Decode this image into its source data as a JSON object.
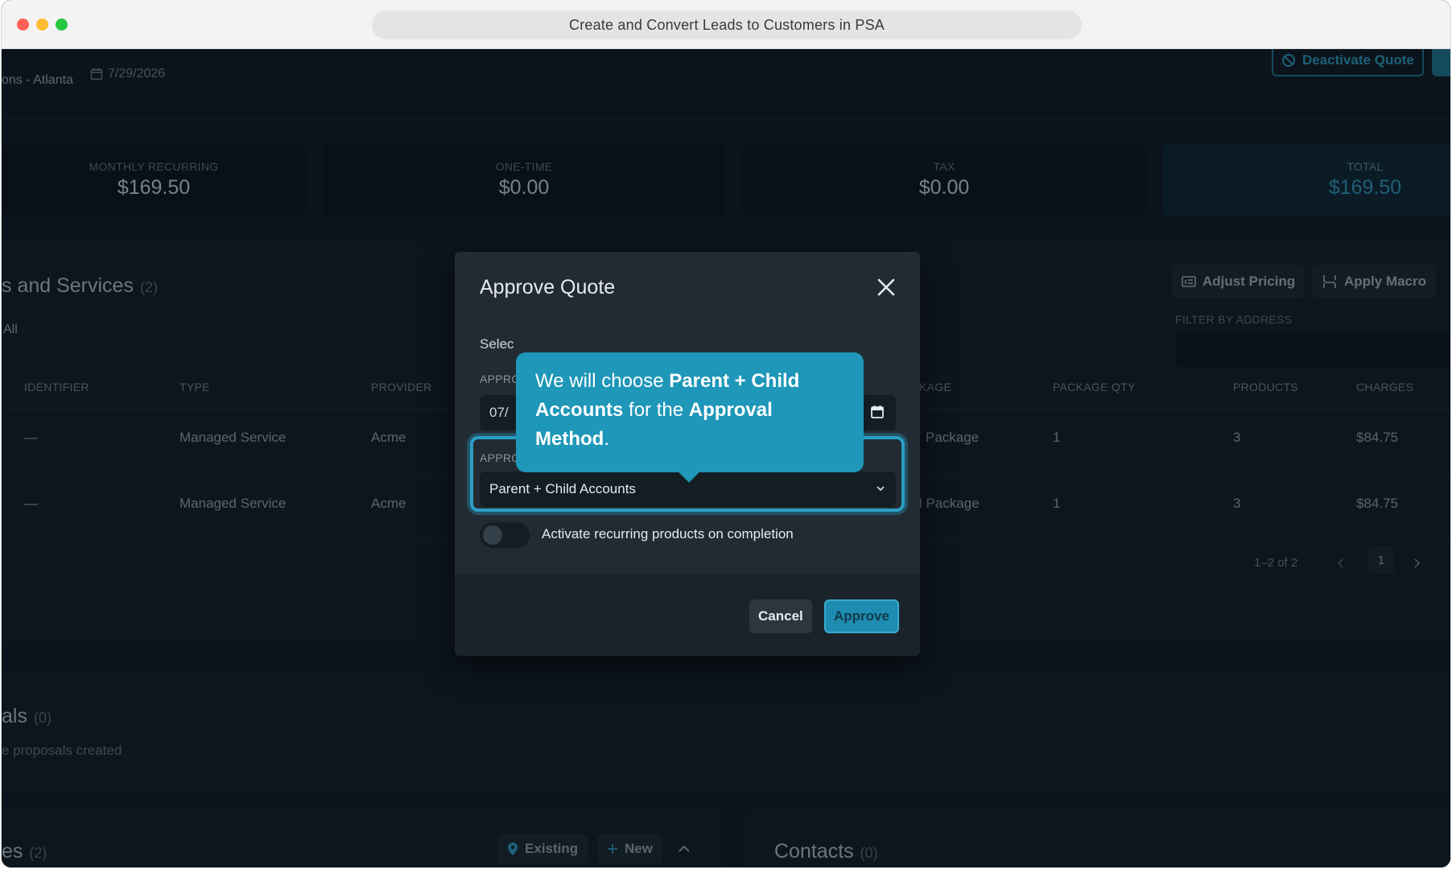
{
  "window": {
    "title": "Create and Convert Leads to Customers in PSA"
  },
  "header": {
    "breadcrumb": "ons - Atlanta",
    "date": "7/29/2026",
    "deactivate_label": "Deactivate Quote"
  },
  "stats": [
    {
      "label": "MONTHLY RECURRING",
      "value": "$169.50"
    },
    {
      "label": "ONE-TIME",
      "value": "$0.00"
    },
    {
      "label": "TAX",
      "value": "$0.00"
    },
    {
      "label": "TOTAL",
      "value": "$169.50"
    }
  ],
  "products": {
    "title": "s and Services",
    "count": "(2)",
    "all_label": "All",
    "adjust_pricing": "Adjust Pricing",
    "apply_macro": "Apply Macro",
    "filter_label": "FILTER BY ADDRESS",
    "columns": [
      "IDENTIFIER",
      "TYPE",
      "PROVIDER",
      "KAGE",
      "PACKAGE QTY",
      "PRODUCTS",
      "CHARGES"
    ],
    "rows": [
      {
        "identifier": "—",
        "type": "Managed Service",
        "provider": "Acme",
        "package": "Package",
        "qty": "1",
        "products": "3",
        "charges": "$84.75"
      },
      {
        "identifier": "—",
        "type": "Managed Service",
        "provider": "Acme",
        "package": "l Package",
        "qty": "1",
        "products": "3",
        "charges": "$84.75"
      }
    ],
    "pager_text": "1–2 of 2",
    "page": "1"
  },
  "proposals": {
    "title": "als",
    "count": "(0)",
    "subtitle": "e proposals created"
  },
  "sites": {
    "title": "es",
    "count": "(2)",
    "existing_label": "Existing",
    "new_label": "New"
  },
  "contacts": {
    "title": "Contacts",
    "count": "(0)"
  },
  "modal": {
    "title": "Approve Quote",
    "select_text": "Selec",
    "approval_date_label": "APPRO",
    "approval_date_value": "07/",
    "approval_method_label": "APPROVAL METHOD",
    "approval_method_value": "Parent + Child Accounts",
    "toggle_label": "Activate recurring products on completion",
    "toggle_on": false,
    "cancel_label": "Cancel",
    "approve_label": "Approve"
  },
  "tooltip": {
    "t1": "We will choose ",
    "b1": "Parent + Child Accounts",
    "t2": " for the ",
    "b2": "Approval Method",
    "t3": "."
  },
  "colors": {
    "accent": "#1e97b9",
    "background": "#0f1b24",
    "modal": "#222b33"
  }
}
